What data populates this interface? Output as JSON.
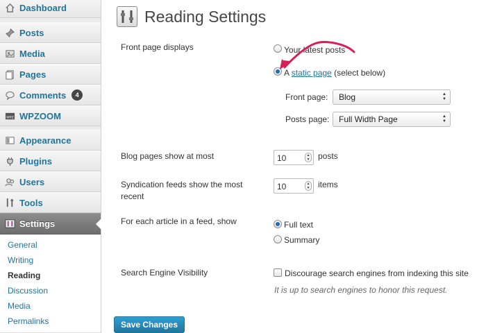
{
  "sidebar": {
    "items": [
      {
        "label": "Dashboard",
        "icon": "house-icon"
      },
      {
        "label": "Posts",
        "icon": "pushpin-icon"
      },
      {
        "label": "Media",
        "icon": "media-icon"
      },
      {
        "label": "Pages",
        "icon": "pages-icon"
      },
      {
        "label": "Comments",
        "icon": "comment-bubble-icon",
        "badge": "4"
      },
      {
        "label": "WPZOOM",
        "icon": "wpzoom-icon"
      },
      {
        "label": "Appearance",
        "icon": "appearance-icon"
      },
      {
        "label": "Plugins",
        "icon": "plug-icon"
      },
      {
        "label": "Users",
        "icon": "users-icon"
      },
      {
        "label": "Tools",
        "icon": "tools-icon"
      },
      {
        "label": "Settings",
        "icon": "settings-icon"
      }
    ],
    "submenu": [
      "General",
      "Writing",
      "Reading",
      "Discussion",
      "Media",
      "Permalinks"
    ]
  },
  "page": {
    "title": "Reading Settings",
    "front_page_label": "Front page displays",
    "option_latest": "Your latest posts",
    "option_static_prefix": "A ",
    "option_static_link": "static page",
    "option_static_suffix": " (select below)",
    "front_page_select_label": "Front page:",
    "front_page_select_value": "Blog",
    "posts_page_select_label": "Posts page:",
    "posts_page_select_value": "Full Width Page",
    "blog_pages_label": "Blog pages show at most",
    "blog_pages_value": "10",
    "blog_pages_unit": "posts",
    "syndication_label": "Syndication feeds show the most recent",
    "syndication_value": "10",
    "syndication_unit": "items",
    "feed_article_label": "For each article in a feed, show",
    "feed_full": "Full text",
    "feed_summary": "Summary",
    "search_visibility_label": "Search Engine Visibility",
    "discourage_label": "Discourage search engines from indexing this site",
    "discourage_hint": "It is up to search engines to honor this request.",
    "save_button": "Save Changes"
  },
  "colors": {
    "link": "#21759b",
    "annotation_arrow": "#d6205a",
    "primary_button": "#21759b"
  }
}
